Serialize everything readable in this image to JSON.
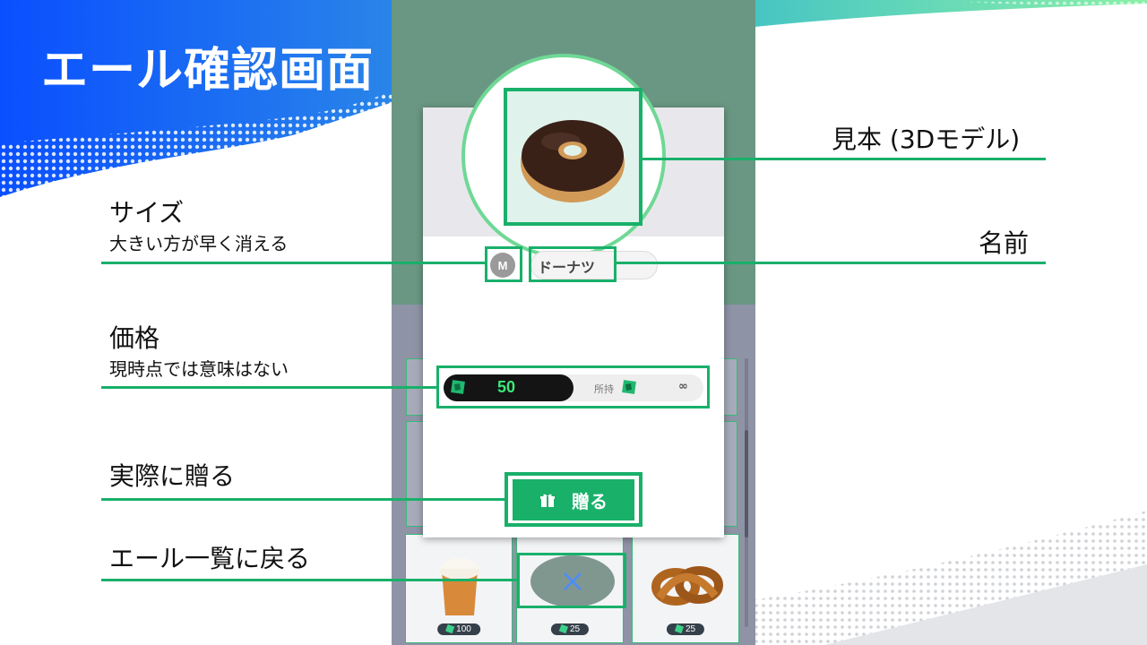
{
  "slide_title": "エール確認画面",
  "annotations": {
    "model": "見本 (3Dモデル)",
    "name": "名前",
    "size": "サイズ",
    "size_desc": "大きい方が早く消える",
    "price": "価格",
    "price_desc": "現時点では意味はない",
    "send": "実際に贈る",
    "back": "エール一覧に戻る"
  },
  "card": {
    "size_badge": "M",
    "item_name": "ドーナツ",
    "price_value": "50",
    "owned_label": "所持",
    "owned_value": "∞",
    "send_button_label": "贈る",
    "close_symbol": "×"
  },
  "list_items": [
    {
      "price": "100",
      "icon": "drink-cup-icon"
    },
    {
      "price": "25",
      "icon": "item-icon"
    },
    {
      "price": "25",
      "icon": "pretzel-icon"
    }
  ],
  "colors": {
    "accent": "#19b06a",
    "title_gradient_start": "#0a4fff",
    "title_gradient_end": "#3fd6a0",
    "price_value": "#3ce87a"
  }
}
